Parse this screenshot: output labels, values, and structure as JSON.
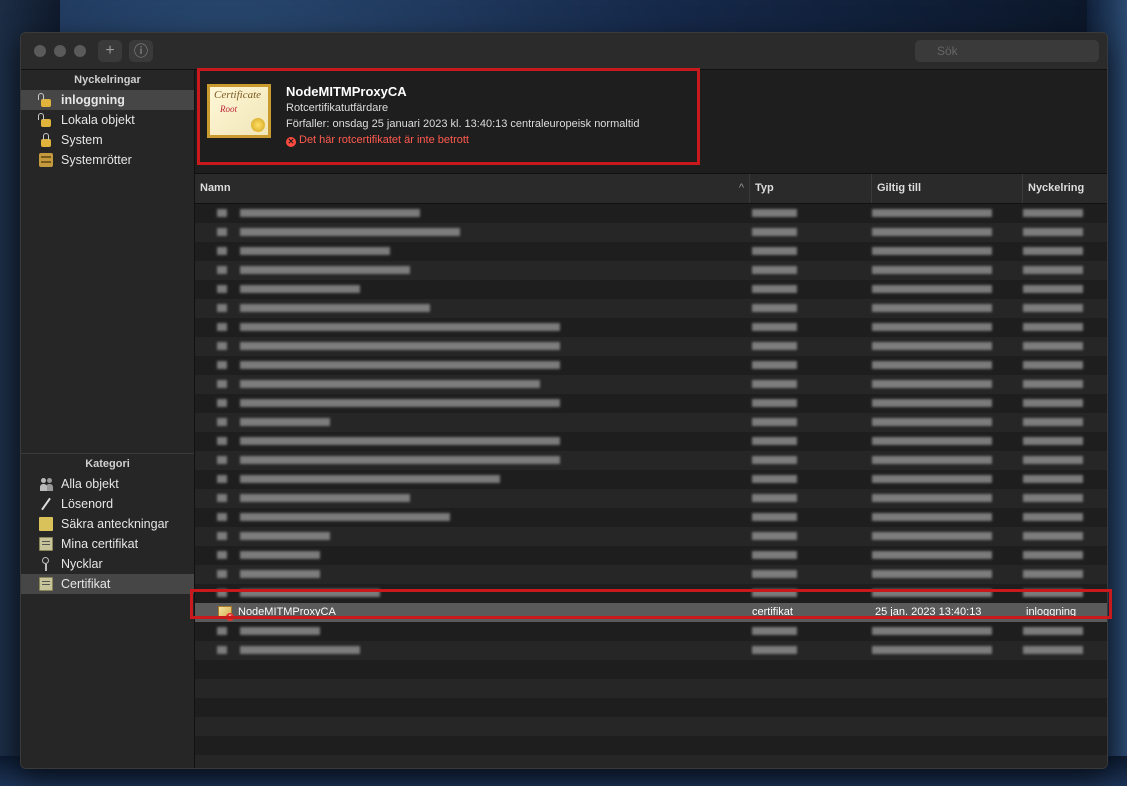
{
  "toolbar": {
    "add_label": "+",
    "info_label": "ⓘ",
    "search_placeholder": "Sök"
  },
  "sidebar": {
    "keychains_header": "Nyckelringar",
    "keychains": [
      {
        "label": "inloggning",
        "icon": "lock-open-icon",
        "selected": true
      },
      {
        "label": "Lokala objekt",
        "icon": "lock-open-icon"
      },
      {
        "label": "System",
        "icon": "lock-icon"
      },
      {
        "label": "Systemrötter",
        "icon": "cabinet-icon"
      }
    ],
    "category_header": "Kategori",
    "categories": [
      {
        "label": "Alla objekt",
        "icon": "people-icon"
      },
      {
        "label": "Lösenord",
        "icon": "pen-icon"
      },
      {
        "label": "Säkra anteckningar",
        "icon": "note-icon"
      },
      {
        "label": "Mina certifikat",
        "icon": "certificate-icon"
      },
      {
        "label": "Nycklar",
        "icon": "key-icon"
      },
      {
        "label": "Certifikat",
        "icon": "certificate-icon",
        "selected": true
      }
    ]
  },
  "detail": {
    "icon_script": "Certificate",
    "icon_root": "Root",
    "title": "NodeMITMProxyCA",
    "subtitle": "Rotcertifikatutfärdare",
    "expires": "Förfaller: onsdag 25 januari 2023 kl. 13:40:13 centraleuropeisk normaltid",
    "warning": "Det här rotcertifikatet är inte betrott"
  },
  "table": {
    "columns": {
      "name": "Namn",
      "type": "Typ",
      "valid": "Giltig till",
      "keychain": "Nyckelring"
    },
    "sort_arrow": "^",
    "selected_row": {
      "name": "NodeMITMProxyCA",
      "type": "certifikat",
      "valid": "25 jan. 2023 13:40:13",
      "keychain": "inloggning"
    }
  },
  "colors": {
    "highlight": "#c8191c",
    "warning": "#ff5a4f"
  }
}
